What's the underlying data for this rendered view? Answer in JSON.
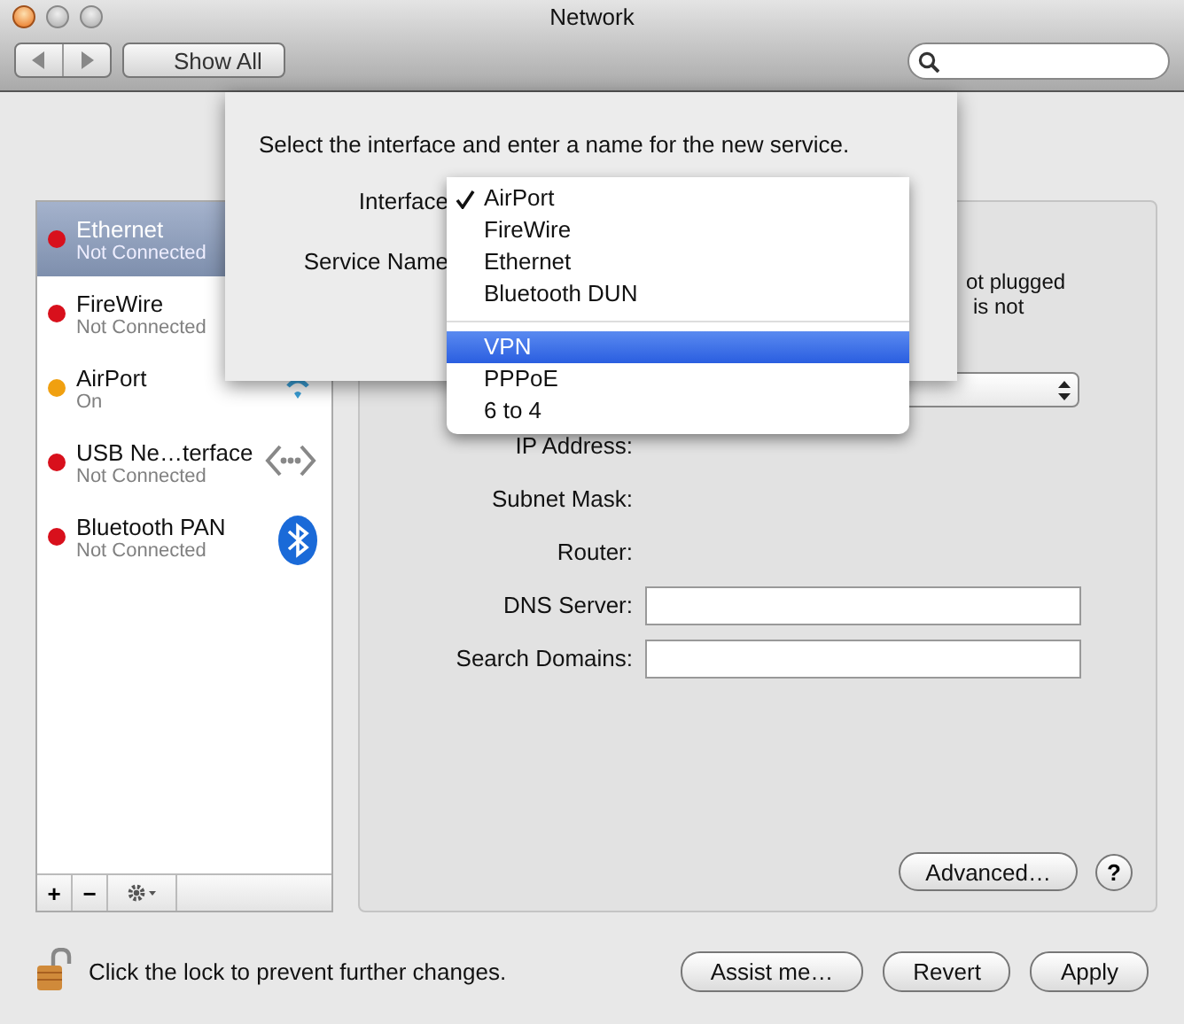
{
  "window": {
    "title": "Network"
  },
  "toolbar": {
    "show_all": "Show All"
  },
  "services": [
    {
      "kind": "plain",
      "name": "Ethernet",
      "status": "Not Connected",
      "color": "#d8101c",
      "selected": true
    },
    {
      "kind": "plain",
      "name": "FireWire",
      "status": "Not Connected",
      "color": "#d8101c",
      "selected": false
    },
    {
      "kind": "wireless",
      "name": "AirPort",
      "status": "On",
      "color": "#f0a010",
      "selected": false
    },
    {
      "kind": "usb",
      "name": "USB Ne…terface",
      "status": "Not Connected",
      "color": "#d8101c",
      "selected": false
    },
    {
      "kind": "bluetooth",
      "name": "Bluetooth PAN",
      "status": "Not Connected",
      "color": "#d8101c",
      "selected": false
    }
  ],
  "service_actions": [
    "+",
    "−"
  ],
  "detail": {
    "status_fragments": [
      "ot plugged",
      "is not"
    ],
    "fields": [
      {
        "label": "IP Address:",
        "kind": "value"
      },
      {
        "label": "Subnet Mask:",
        "kind": "value"
      },
      {
        "label": "Router:",
        "kind": "value"
      },
      {
        "label": "DNS Server:",
        "kind": "input"
      },
      {
        "label": "Search Domains:",
        "kind": "input"
      }
    ],
    "advanced_button": "Advanced…",
    "help_button": "?"
  },
  "footer": {
    "lock_text": "Click the lock to prevent further changes.",
    "buttons": [
      "Assist me…",
      "Revert",
      "Apply"
    ]
  },
  "sheet": {
    "prompt": "Select the interface and enter a name for the new service.",
    "interface_label": "Interface",
    "service_name_label": "Service Name",
    "menu": [
      {
        "kind": "item",
        "label": "AirPort",
        "checked": true,
        "selected": false
      },
      {
        "kind": "item",
        "label": "FireWire",
        "checked": false,
        "selected": false
      },
      {
        "kind": "item",
        "label": "Ethernet",
        "checked": false,
        "selected": false
      },
      {
        "kind": "item",
        "label": "Bluetooth DUN",
        "checked": false,
        "selected": false
      },
      {
        "kind": "separator"
      },
      {
        "kind": "item",
        "label": "VPN",
        "checked": false,
        "selected": true
      },
      {
        "kind": "item",
        "label": "PPPoE",
        "checked": false,
        "selected": false
      },
      {
        "kind": "item",
        "label": "6 to 4",
        "checked": false,
        "selected": false
      }
    ]
  }
}
